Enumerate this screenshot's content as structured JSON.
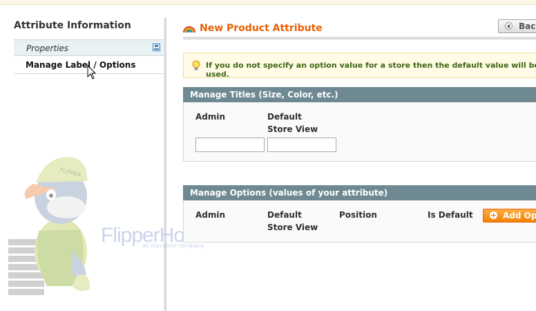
{
  "sidebar": {
    "title": "Attribute Information",
    "tabs": [
      {
        "label": "Properties"
      },
      {
        "label": "Manage Label / Options"
      }
    ]
  },
  "header": {
    "page_title": "New Product Attribute",
    "back_label": "Back"
  },
  "notice": {
    "text": "If you do not specify an option value for a store then the default value will be used."
  },
  "manage_titles": {
    "heading": "Manage Titles (Size, Color, etc.)",
    "columns": [
      "Admin",
      "Default Store View"
    ],
    "values": [
      "",
      ""
    ]
  },
  "manage_options": {
    "heading": "Manage Options (values of your attribute)",
    "columns": [
      "Admin",
      "Default Store View",
      "Position",
      "Is Default"
    ],
    "add_option_label": "Add Option"
  },
  "watermark": {
    "brand": "FlipperHost",
    "tagline": "an inovation company"
  },
  "colors": {
    "accent": "#eb5e00",
    "fieldset_header": "#6f8992",
    "notice_text": "#3d6611",
    "button_orange": "#f18200"
  },
  "icons": [
    "save-icon",
    "rainbow-icon",
    "back-arrow-icon",
    "lightbulb-icon",
    "plus-icon",
    "mouse-cursor-icon",
    "mascot-illustration"
  ]
}
